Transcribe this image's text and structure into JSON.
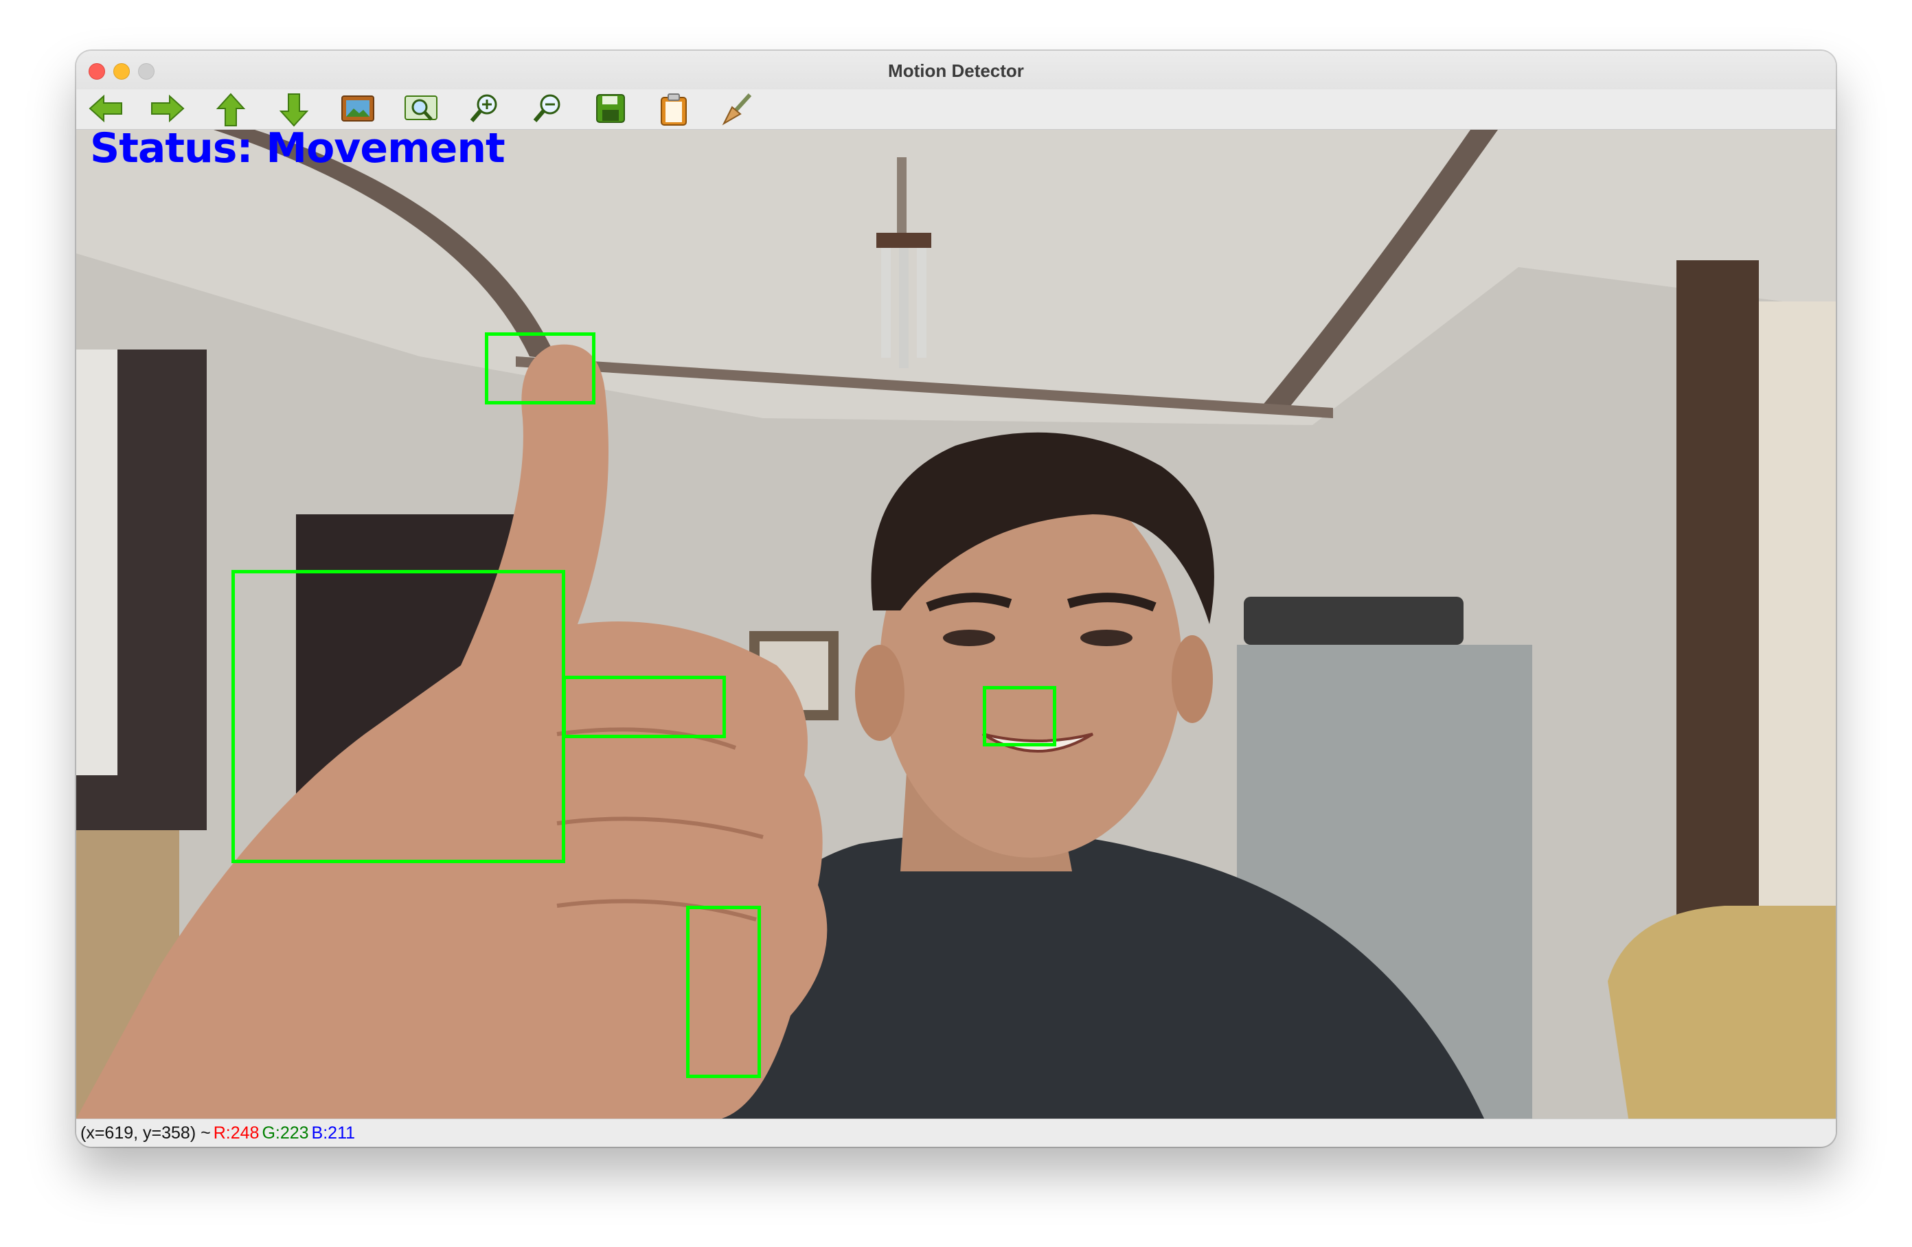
{
  "window": {
    "title": "Motion Detector"
  },
  "toolbar": {
    "buttons": [
      {
        "icon": "arrow-left-icon"
      },
      {
        "icon": "arrow-right-icon"
      },
      {
        "icon": "arrow-up-icon"
      },
      {
        "icon": "arrow-down-icon"
      },
      {
        "icon": "image-icon"
      },
      {
        "icon": "zoom-fit-icon"
      },
      {
        "icon": "zoom-in-icon"
      },
      {
        "icon": "zoom-out-icon"
      },
      {
        "icon": "save-icon"
      },
      {
        "icon": "clipboard-icon"
      },
      {
        "icon": "brush-icon"
      }
    ]
  },
  "overlay": {
    "status_text": "Status: Movement",
    "status_color": "#0000ff",
    "box_color": "#00ff00",
    "detection_box_count": 5
  },
  "statusbar": {
    "coords": "(x=619, y=358) ~",
    "r": "R:248",
    "g": "G:223",
    "b": "B:211",
    "r_color": "#ff0000",
    "g_color": "#008000",
    "b_color": "#0000ff"
  }
}
